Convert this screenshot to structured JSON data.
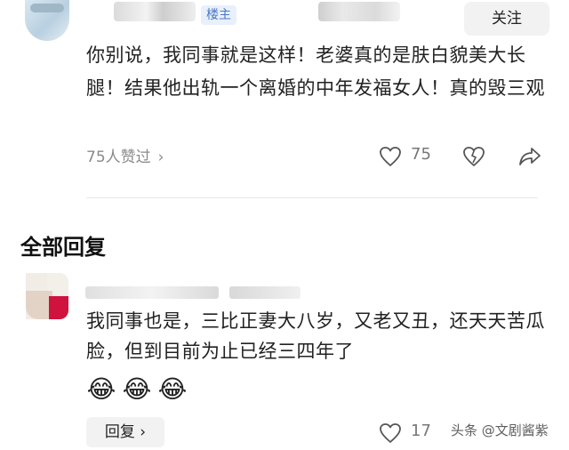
{
  "comment_top": {
    "author_tag": "楼主",
    "follow_label": "关注",
    "text": "你别说，我同事就是这样！老婆真的是肤白貌美大长腿！结果他出轨一个离婚的中年发福女人！真的毁三观",
    "likes_link": "75人赞过",
    "like_count": "75",
    "icons": [
      "heart-icon",
      "dislike-heart-icon",
      "share-icon",
      "chevron-right-icon"
    ]
  },
  "section": {
    "title": "全部回复"
  },
  "reply": {
    "text": "我同事也是，三比正妻大八岁，又老又丑，还天天苦瓜脸，但到目前为止已经三四年了",
    "emojis": [
      "😂",
      "😂",
      "😂"
    ],
    "reply_label": "回复",
    "like_count": "17",
    "icons": [
      "heart-icon",
      "chevron-right-icon"
    ]
  },
  "watermark": "头条 @文剧酱紫",
  "colors": {
    "tag_bg": "#e8f0fb",
    "tag_text": "#4a77c9",
    "button_bg": "#f2f2f2",
    "meta_text": "#8a8a8a"
  }
}
